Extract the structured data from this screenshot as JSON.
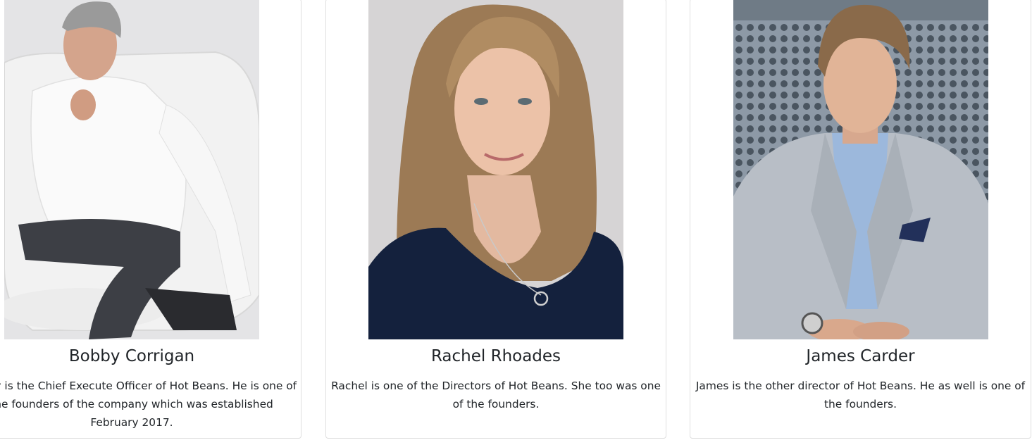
{
  "team": [
    {
      "name": "Bobby Corrigan",
      "description": "Bobby is the Chief Execute Officer of Hot Beans. He is one of the founders of the company which was established February 2017.",
      "photo_icon": "person-photo"
    },
    {
      "name": "Rachel Rhoades",
      "description": "Rachel is one of the Directors of Hot Beans. She too was one of the founders.",
      "photo_icon": "person-photo"
    },
    {
      "name": "James Carder",
      "description": "James is the other director of Hot Beans. He as well is one of the founders.",
      "photo_icon": "person-photo"
    }
  ],
  "colors": {
    "card_border": "#dfdfdf",
    "text": "#212529",
    "background": "#ffffff"
  }
}
